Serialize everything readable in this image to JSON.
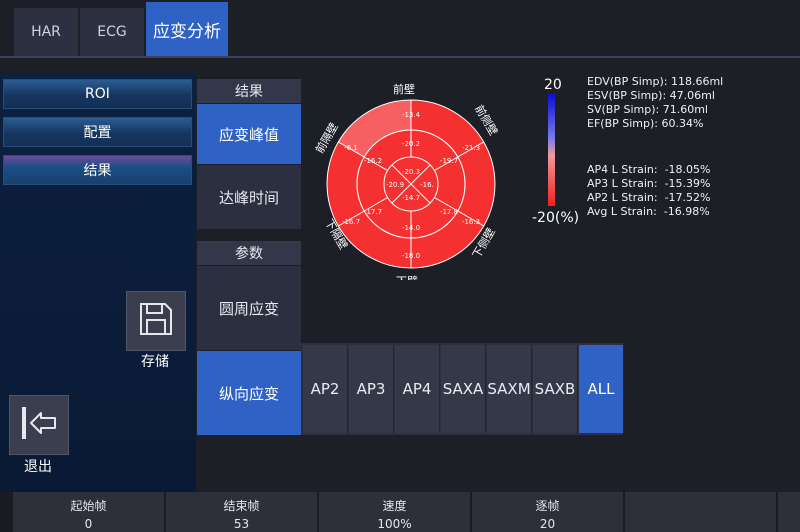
{
  "tabs": [
    {
      "label": "HAR"
    },
    {
      "label": "ECG"
    },
    {
      "label": "应变分析"
    }
  ],
  "nav": {
    "roi": "ROI",
    "config": "配置",
    "result": "结果"
  },
  "actions": {
    "save": "存储",
    "exit": "退出"
  },
  "results_panel": {
    "header": "结果",
    "peak_strain": "应变峰值",
    "time_to_peak": "达峰时间"
  },
  "params_panel": {
    "header": "参数",
    "circumferential": "圆周应变",
    "longitudinal": "纵向应变"
  },
  "views": [
    "AP2",
    "AP3",
    "AP4",
    "SAXA",
    "SAXM",
    "SAXB",
    "ALL"
  ],
  "active_view": "ALL",
  "bullseye": {
    "labels": {
      "anterior": "前壁",
      "anterolateral": "前侧壁",
      "inferolateral": "下侧壁",
      "inferior": "下壁",
      "inferoseptal": "下隔壁",
      "anteroseptal": "前隔壁"
    },
    "basal": [
      "-13.4",
      "-21.3",
      "-16.3",
      "-18.0",
      "-16.7",
      "-6.1"
    ],
    "mid": [
      "-20.2",
      "-19.7",
      "-17.8",
      "-14.0",
      "-17.7",
      "-16.2"
    ],
    "apical": [
      "-20.3",
      "-16.",
      "-14.7",
      "-20.9"
    ]
  },
  "colorbar": {
    "max_label": "20",
    "min_label": "-20(%)"
  },
  "volumes": [
    "EDV(BP Simp): 118.66ml",
    "ESV(BP Simp): 47.06ml",
    "SV(BP Simp): 71.60ml",
    "EF(BP Simp): 60.34%"
  ],
  "strains": [
    "AP4 L Strain:  -18.05%",
    "AP3 L Strain:  -15.39%",
    "AP2 L Strain:  -17.52%",
    "Avg L Strain:  -16.98%"
  ],
  "bottom": [
    {
      "title": "起始帧",
      "value": "0"
    },
    {
      "title": "结束帧",
      "value": "53"
    },
    {
      "title": "速度",
      "value": "100%"
    },
    {
      "title": "逐帧",
      "value": "20"
    }
  ],
  "colors": {
    "accent": "#2f62c4",
    "segment_fill": "#f43030",
    "segment_light": "#f66060"
  }
}
